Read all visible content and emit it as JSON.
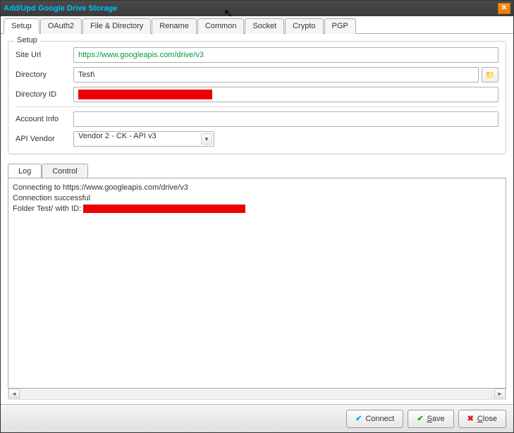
{
  "window": {
    "title": "Add/Upd Google Drive Storage"
  },
  "tabs": [
    "Setup",
    "OAuth2",
    "File & Directory",
    "Rename",
    "Common",
    "Socket",
    "Crypto",
    "PGP"
  ],
  "active_tab": 0,
  "fieldset": {
    "legend": "Setup"
  },
  "form": {
    "site_url": {
      "label": "Site Url",
      "value": "https://www.googleapis.com/drive/v3"
    },
    "directory": {
      "label": "Directory",
      "value": "Test\\"
    },
    "directory_id": {
      "label": "Directory ID",
      "value": ""
    },
    "account_info": {
      "label": "Account Info",
      "value": ""
    },
    "api_vendor": {
      "label": "API Vendor",
      "selected": "Vendor 2 - CK - API v3"
    }
  },
  "log_tabs": [
    "Log",
    "Control"
  ],
  "log_active": 0,
  "log": {
    "line1": "Connecting to https://www.googleapis.com/drive/v3",
    "line2": "Connection successful",
    "line3_prefix": "Folder Test/ with ID: "
  },
  "footer": {
    "connect": "Connect",
    "save_u": "S",
    "save_rest": "ave",
    "close_u": "C",
    "close_rest": "lose"
  }
}
